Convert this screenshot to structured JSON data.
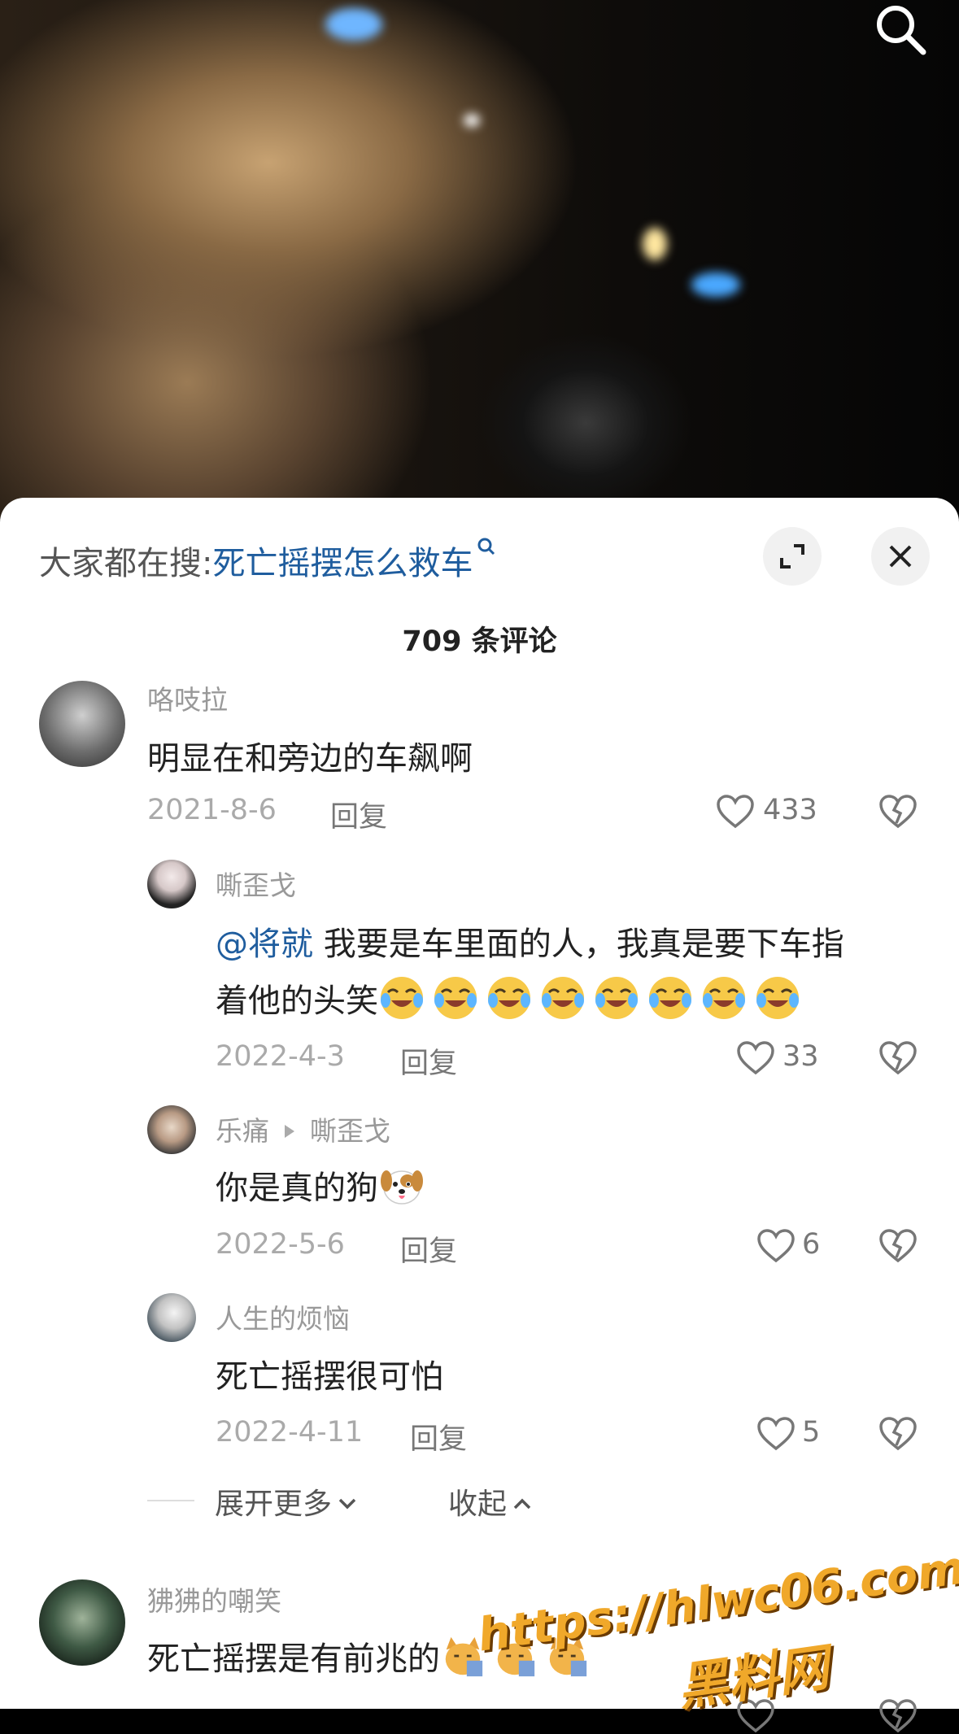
{
  "hint": {
    "prefix": "大家都在搜:",
    "query": "死亡摇摆怎么救车"
  },
  "comment_count": "709 条评论",
  "comments": [
    {
      "user": "咯吱拉",
      "text": "明显在和旁边的车飙啊",
      "date": "2021-8-6",
      "reply": "回复",
      "likes": "433"
    },
    {
      "user": "嘶歪戈",
      "mention": "@将就",
      "text": " 我要是车里面的人，我真是要下车指",
      "text2": "着他的头笑",
      "date": "2022-4-3",
      "reply": "回复",
      "likes": "33"
    },
    {
      "user": "乐痛",
      "reply_to": "嘶歪戈",
      "text": "你是真的狗",
      "date": "2022-5-6",
      "reply": "回复",
      "likes": "6"
    },
    {
      "user": "人生的烦恼",
      "text": "死亡摇摆很可怕",
      "date": "2022-4-11",
      "reply": "回复",
      "likes": "5"
    },
    {
      "user": "狒狒的嘲笑",
      "text": "死亡摇摆是有前兆的"
    }
  ],
  "expand_more": "展开更多",
  "collapse": "收起",
  "watermark": {
    "url": "https://hlwc06.com",
    "site": "黑料网"
  },
  "icons": [
    "search-icon",
    "expand-icon",
    "close-icon",
    "heart-icon",
    "dislike-icon",
    "chevron-down-icon",
    "chevron-up-icon",
    "laugh-cry-emoji",
    "dog-emoji",
    "cat-emoji"
  ],
  "colors": {
    "accent": "#1f5d9e",
    "watermark": "#f0a82a"
  }
}
